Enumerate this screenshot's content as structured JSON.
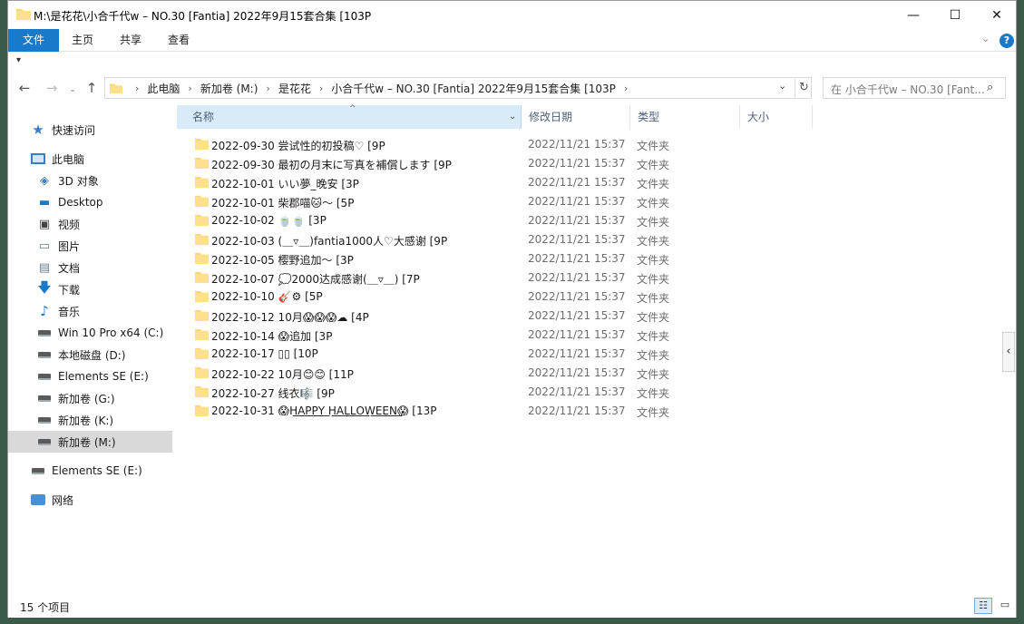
{
  "window": {
    "title": "M:\\是花花\\小合千代w – NO.30 [Fantia] 2022年9月15套合集 [103P",
    "minimize": "—",
    "maximize": "☐",
    "close": "✕"
  },
  "ribbon": {
    "tabs": [
      "文件",
      "主页",
      "共享",
      "查看"
    ],
    "expand_icon": "chevron-down-icon",
    "help": "?"
  },
  "nav": {
    "back": "←",
    "forward": "→",
    "recent": "⌄",
    "up": "↑",
    "breadcrumbs": [
      "此电脑",
      "新加卷 (M:)",
      "是花花",
      "小合千代w – NO.30 [Fantia] 2022年9月15套合集 [103P"
    ],
    "separator": "›",
    "address_dropdown": "⌄",
    "refresh": "↻",
    "search_placeholder": "在 小合千代w – NO.30 [Fant...",
    "search_icon": "⌕"
  },
  "sidebar": {
    "items": [
      {
        "label": "快速访问",
        "icon": "star-icon"
      },
      {
        "label": "此电脑",
        "icon": "computer-icon"
      },
      {
        "label": "3D 对象",
        "icon": "cube-icon"
      },
      {
        "label": "Desktop",
        "icon": "desktop-icon"
      },
      {
        "label": "视频",
        "icon": "video-icon"
      },
      {
        "label": "图片",
        "icon": "picture-icon"
      },
      {
        "label": "文档",
        "icon": "document-icon"
      },
      {
        "label": "下载",
        "icon": "download-icon"
      },
      {
        "label": "音乐",
        "icon": "music-icon"
      },
      {
        "label": "Win 10 Pro x64 (C:)",
        "icon": "drive-icon"
      },
      {
        "label": "本地磁盘 (D:)",
        "icon": "drive-icon"
      },
      {
        "label": "Elements SE (E:)",
        "icon": "drive-icon"
      },
      {
        "label": "新加卷 (G:)",
        "icon": "drive-icon"
      },
      {
        "label": "新加卷 (K:)",
        "icon": "drive-icon"
      },
      {
        "label": "新加卷 (M:)",
        "icon": "drive-icon"
      },
      {
        "label": "Elements SE (E:)",
        "icon": "drive-icon"
      },
      {
        "label": "网络",
        "icon": "network-icon"
      }
    ]
  },
  "columns": {
    "name": "名称",
    "date": "修改日期",
    "type": "类型",
    "size": "大小",
    "sort_arrow": "^",
    "name_dropdown": "⌄"
  },
  "files": [
    {
      "name": "2022-09-30 尝试性的初投稿♡ [9P",
      "date": "2022/11/21 15:37",
      "type": "文件夹"
    },
    {
      "name": "2022-09-30 最初の月末に写真を補償します [9P",
      "date": "2022/11/21 15:37",
      "type": "文件夹"
    },
    {
      "name": "2022-10-01 いい夢_晚安 [3P",
      "date": "2022/11/21 15:37",
      "type": "文件夹"
    },
    {
      "name": "2022-10-01 柴郡喵🐱～ [5P",
      "date": "2022/11/21 15:37",
      "type": "文件夹"
    },
    {
      "name": "2022-10-02 🍵🍵 [3P",
      "date": "2022/11/21 15:37",
      "type": "文件夹"
    },
    {
      "name": "2022-10-03 (＿▿＿)fantia1000人♡大感谢 [9P",
      "date": "2022/11/21 15:37",
      "type": "文件夹"
    },
    {
      "name": "2022-10-05 樱野追加～ [3P",
      "date": "2022/11/21 15:37",
      "type": "文件夹"
    },
    {
      "name": "2022-10-07 💭2000达成感谢(＿▿＿) [7P",
      "date": "2022/11/21 15:37",
      "type": "文件夹"
    },
    {
      "name": "2022-10-10 🎸⚙ [5P",
      "date": "2022/11/21 15:37",
      "type": "文件夹"
    },
    {
      "name": "2022-10-12 10月😱😱😱☁ [4P",
      "date": "2022/11/21 15:37",
      "type": "文件夹"
    },
    {
      "name": "2022-10-14 😱追加 [3P",
      "date": "2022/11/21 15:37",
      "type": "文件夹"
    },
    {
      "name": "2022-10-17 ▯▯ [10P",
      "date": "2022/11/21 15:37",
      "type": "文件夹"
    },
    {
      "name": "2022-10-22 10月😊😊 [11P",
      "date": "2022/11/21 15:37",
      "type": "文件夹"
    },
    {
      "name": "2022-10-27 线衣🎼 [9P",
      "date": "2022/11/21 15:37",
      "type": "文件夹"
    },
    {
      "name": "2022-10-31 😱H͟A͟P͟P͟Y͟ H͟A͟L͟L͟O͟W͟E͟E͟N͟😱 [13P",
      "date": "2022/11/21 15:37",
      "type": "文件夹"
    }
  ],
  "status": {
    "count": "15 个项目",
    "details_view": "☷",
    "tiles_view": "▭"
  },
  "pane_toggle": "‹",
  "colors": {
    "accent": "#1979ca",
    "folder": "#f8d775",
    "header_selected": "#d9ebf9",
    "sidebar_selected": "#d9d9d9"
  }
}
